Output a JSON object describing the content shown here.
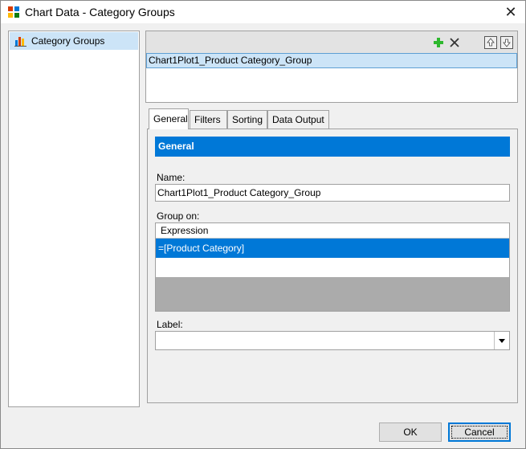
{
  "window": {
    "title": "Chart Data - Category Groups",
    "close_glyph": "✕"
  },
  "tree": {
    "items": [
      {
        "label": "Category Groups",
        "icon": "chart-bars-icon",
        "selected": true
      }
    ]
  },
  "group_list": {
    "toolbar": [
      "add-icon",
      "delete-icon",
      "move-up-icon",
      "move-down-icon"
    ],
    "items": [
      {
        "label": "Chart1Plot1_Product Category_Group",
        "selected": true
      }
    ]
  },
  "tabs": [
    {
      "label": "General",
      "active": true
    },
    {
      "label": "Filters",
      "active": false
    },
    {
      "label": "Sorting",
      "active": false
    },
    {
      "label": "Data Output",
      "active": false
    }
  ],
  "general": {
    "header": "General",
    "name_label": "Name:",
    "name_value": "Chart1Plot1_Product Category_Group",
    "group_on_label": "Group on:",
    "grid": {
      "column": "Expression",
      "rows": [
        "=[Product Category]"
      ]
    },
    "label_label": "Label:",
    "label_value": ""
  },
  "buttons": {
    "ok": "OK",
    "cancel": "Cancel"
  },
  "colors": {
    "accent": "#0078d7",
    "selection": "#cce4f7",
    "add_green": "#2eb82e"
  }
}
